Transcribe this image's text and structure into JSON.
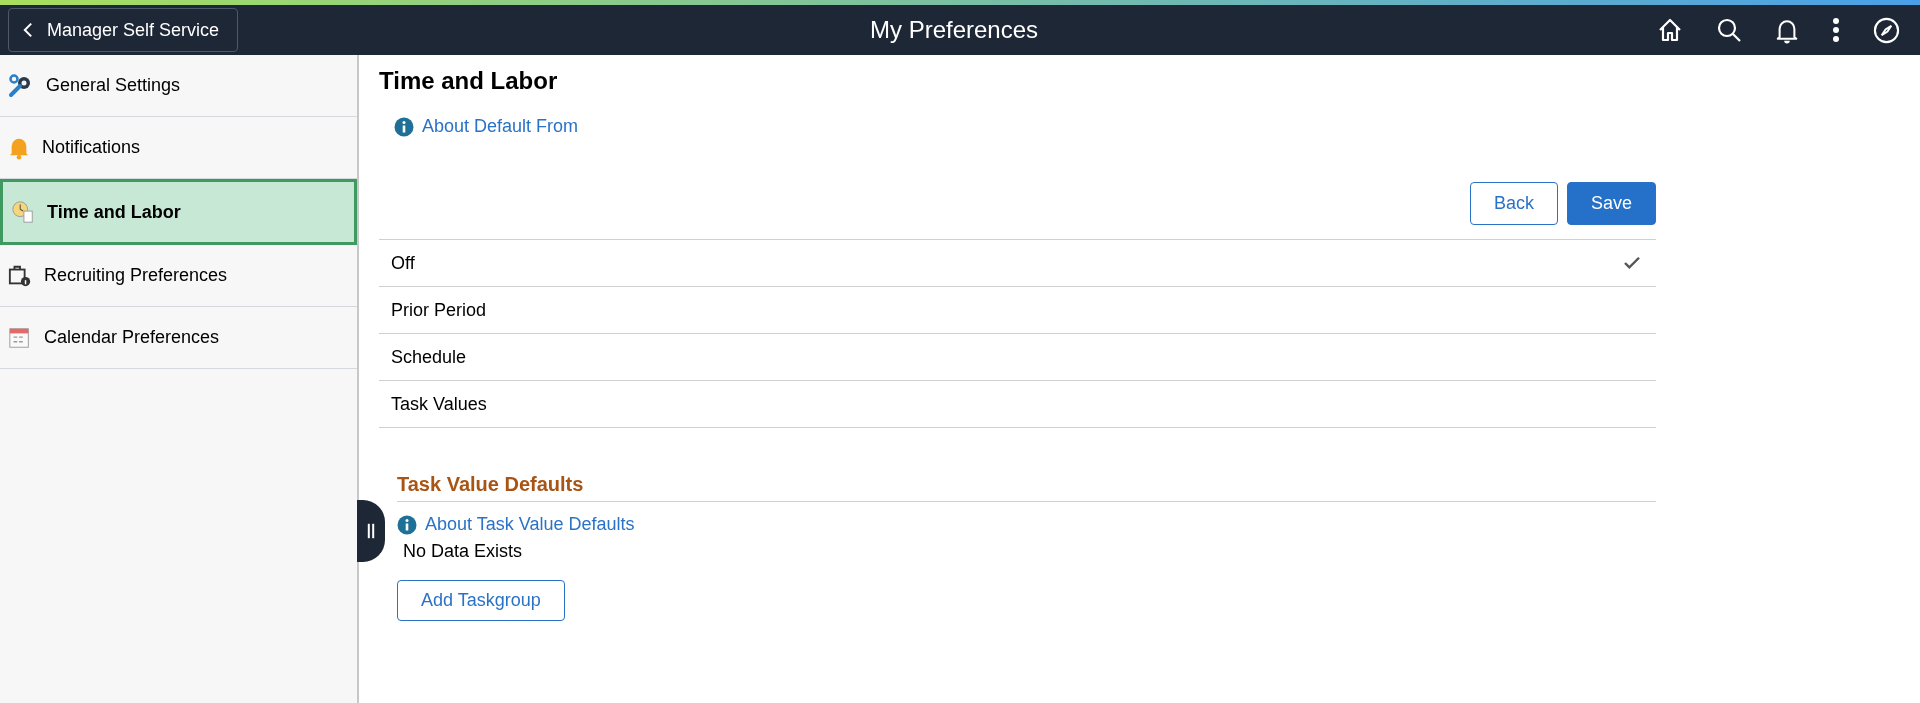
{
  "header": {
    "back_button": "Manager Self Service",
    "title": "My Preferences"
  },
  "sidebar": {
    "items": [
      {
        "label": "General Settings",
        "kind": "settings",
        "selected": false
      },
      {
        "label": "Notifications",
        "kind": "bell",
        "selected": false
      },
      {
        "label": "Time and Labor",
        "kind": "clock",
        "selected": true
      },
      {
        "label": "Recruiting Preferences",
        "kind": "briefcase",
        "selected": false
      },
      {
        "label": "Calendar Preferences",
        "kind": "calendar",
        "selected": false
      }
    ]
  },
  "content": {
    "title": "Time and Labor",
    "info_link": "About Default From",
    "buttons": {
      "back": "Back",
      "save": "Save"
    },
    "options": [
      {
        "label": "Off",
        "selected": true
      },
      {
        "label": "Prior Period",
        "selected": false
      },
      {
        "label": "Schedule",
        "selected": false
      },
      {
        "label": "Task Values",
        "selected": false
      }
    ],
    "section": {
      "title": "Task Value Defaults",
      "info_link": "About Task Value Defaults",
      "empty_text": "No Data Exists",
      "add_button": "Add Taskgroup"
    }
  }
}
